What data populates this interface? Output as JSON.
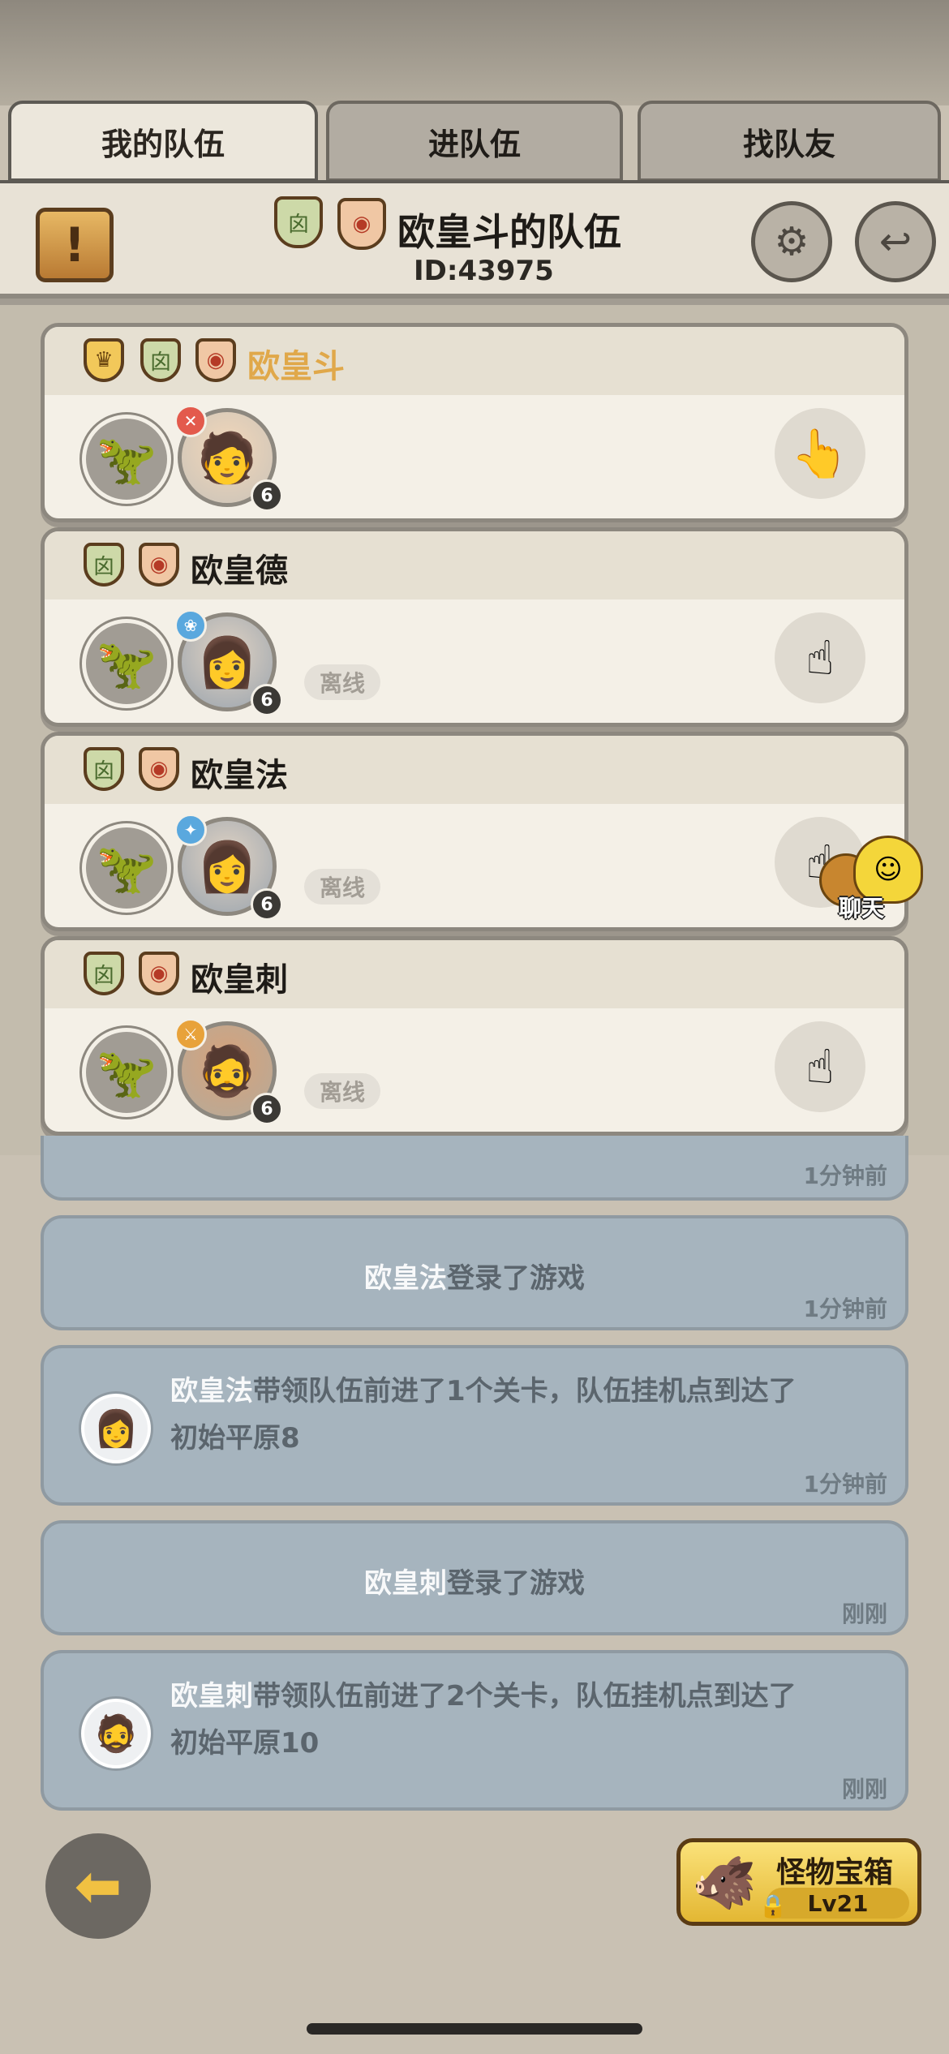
{
  "tabs": [
    {
      "label": "我的队伍",
      "active": true
    },
    {
      "label": "进队伍",
      "active": false
    },
    {
      "label": "找队友",
      "active": false
    }
  ],
  "header": {
    "title": "欧皇斗的队伍",
    "id_text": "ID:43975"
  },
  "members": [
    {
      "name": "欧皇斗",
      "leader": true,
      "level": "6",
      "status": "",
      "class_color": "#e35a4c",
      "action_icon": "hand-card-icon"
    },
    {
      "name": "欧皇德",
      "leader": false,
      "level": "6",
      "status": "离线",
      "class_color": "#5aa8de",
      "action_icon": "swap-star-icon"
    },
    {
      "name": "欧皇法",
      "leader": false,
      "level": "6",
      "status": "离线",
      "class_color": "#5aa8de",
      "action_icon": "swap-star-icon"
    },
    {
      "name": "欧皇刺",
      "leader": false,
      "level": "6",
      "status": "离线",
      "class_color": "#e8a23a",
      "action_icon": "swap-star-icon"
    }
  ],
  "chat": {
    "label": "聊天"
  },
  "feed": [
    {
      "time": "1分钟前"
    },
    {
      "name": "欧皇法",
      "text": "登录了游戏",
      "time": "1分钟前"
    },
    {
      "name": "欧皇法",
      "text": "带领队伍前进了1个关卡，队伍挂机点到达了",
      "text2": "初始平原8",
      "time": "1分钟前"
    },
    {
      "name": "欧皇刺",
      "text": "登录了游戏",
      "time": "刚刚"
    },
    {
      "name": "欧皇刺",
      "text": "带领队伍前进了2个关卡，队伍挂机点到达了",
      "text2": "初始平原10",
      "time": "刚刚"
    }
  ],
  "chest": {
    "title": "怪物宝箱",
    "level": "Lv21"
  }
}
